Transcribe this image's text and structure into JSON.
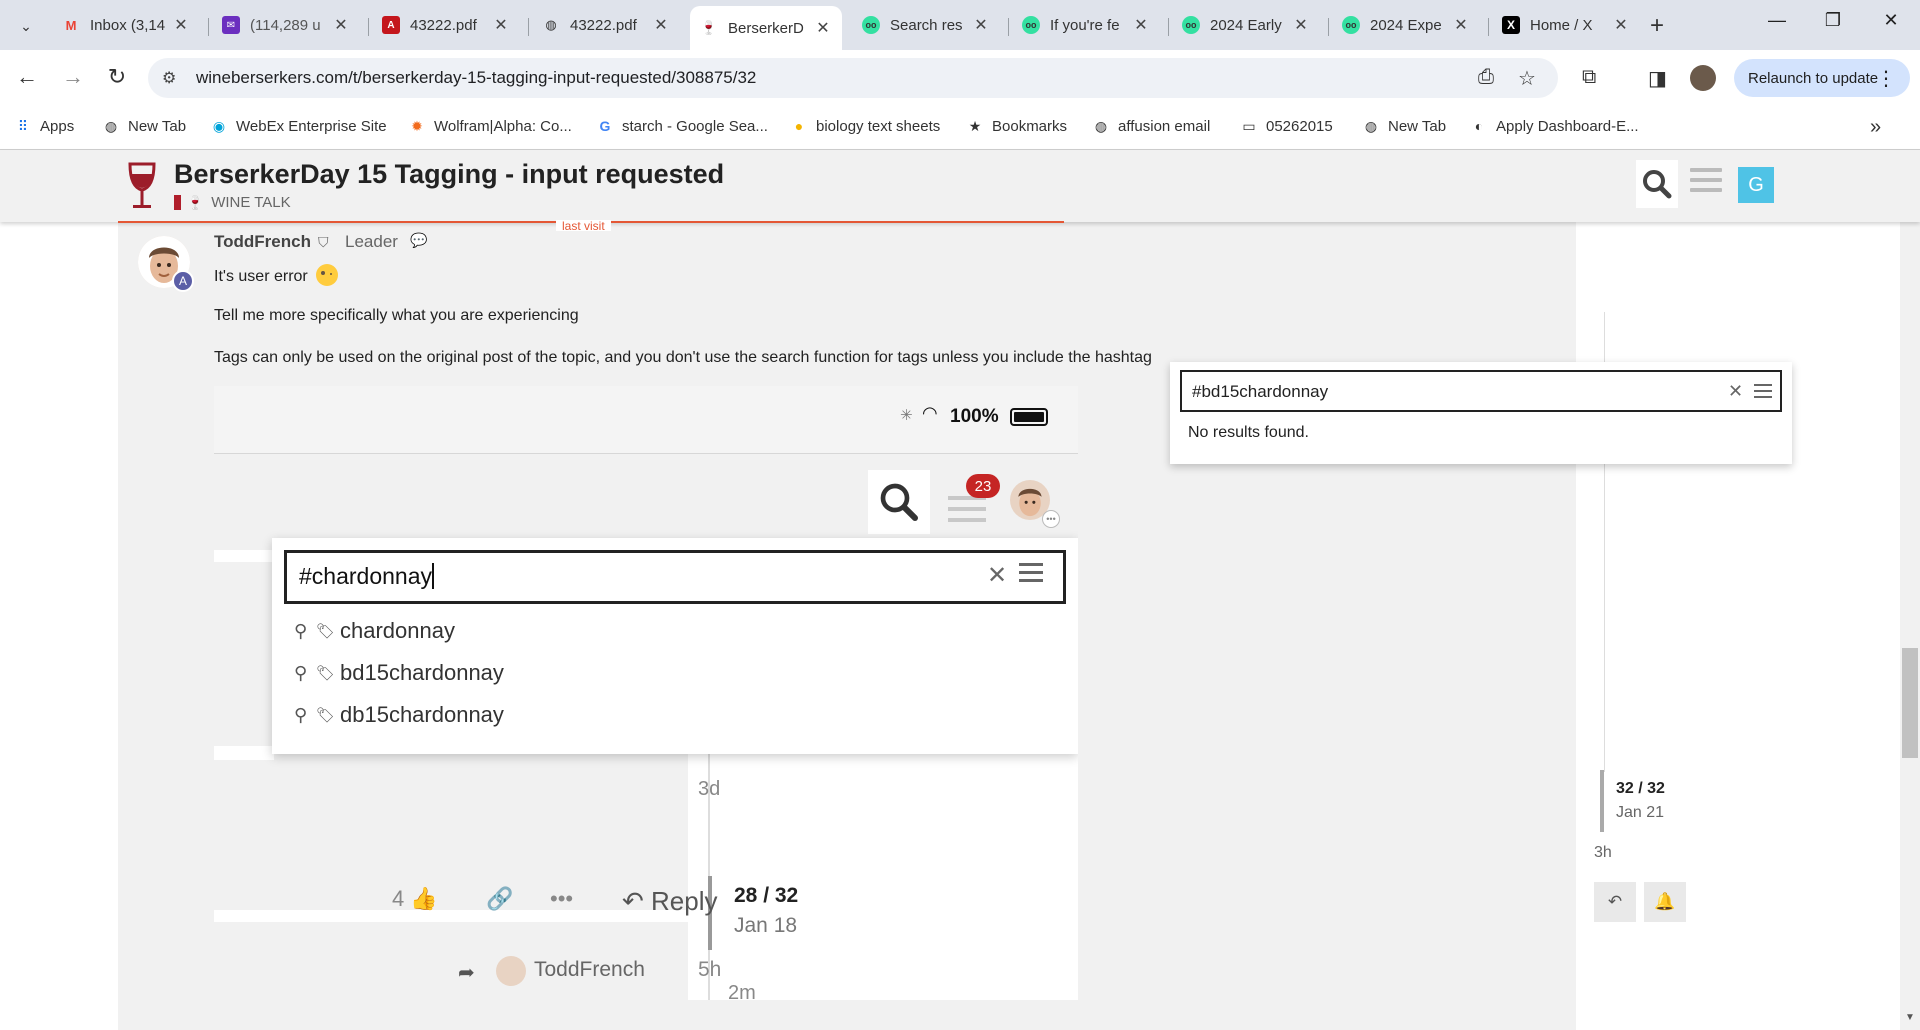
{
  "browser": {
    "tabs": [
      {
        "title": "Inbox (3,14",
        "icon": "gmail-icon",
        "active": false
      },
      {
        "title": "(114,289 u",
        "icon": "mail-icon",
        "active": false
      },
      {
        "title": "43222.pdf",
        "icon": "pdf-icon",
        "active": false
      },
      {
        "title": "43222.pdf",
        "icon": "globe-icon",
        "active": false
      },
      {
        "title": "BerserkerD",
        "icon": "wine-glass-icon",
        "active": true
      },
      {
        "title": "Search res",
        "icon": "tripadvisor-icon",
        "active": false
      },
      {
        "title": "If you're fe",
        "icon": "tripadvisor-icon",
        "active": false
      },
      {
        "title": "2024 Early",
        "icon": "tripadvisor-icon",
        "active": false
      },
      {
        "title": "2024 Expe",
        "icon": "tripadvisor-icon",
        "active": false
      },
      {
        "title": "Home / X",
        "icon": "x-logo-icon",
        "active": false
      }
    ],
    "url": "wineberserkers.com/t/berserkerday-15-tagging-input-requested/308875/32",
    "relaunch_label": "Relaunch to update",
    "bookmarks": [
      {
        "label": "Apps",
        "icon": "apps-grid-icon"
      },
      {
        "label": "New Tab",
        "icon": "globe-icon"
      },
      {
        "label": "WebEx Enterprise Site",
        "icon": "webex-icon"
      },
      {
        "label": "Wolfram|Alpha: Co...",
        "icon": "wolfram-icon"
      },
      {
        "label": "starch - Google Sea...",
        "icon": "google-icon"
      },
      {
        "label": "biology text sheets",
        "icon": "circle-icon"
      },
      {
        "label": "Bookmarks",
        "icon": "star-icon"
      },
      {
        "label": "affusion email",
        "icon": "globe-icon"
      },
      {
        "label": "05262015",
        "icon": "folder-icon"
      },
      {
        "label": "New Tab",
        "icon": "globe-icon"
      },
      {
        "label": "Apply Dashboard-E...",
        "icon": "github-icon"
      }
    ]
  },
  "header": {
    "title": "BerserkerDay 15 Tagging - input requested",
    "category": "WINE TALK",
    "user_initial": "G",
    "last_visit": "last visit"
  },
  "post": {
    "username": "ToddFrench",
    "user_title": "Leader",
    "avatar_badge": "A",
    "lines": [
      "It's user error",
      "Tell me more specifically what you are experiencing",
      "Tags can only be used on the original post of the topic, and you don't use the search function for tags unless you include the hashtag"
    ]
  },
  "embed": {
    "battery": "100%",
    "notification_count": "23",
    "search_value": "#chardonnay",
    "suggestions": [
      "chardonnay",
      "bd15chardonnay",
      "db15chardonnay"
    ],
    "age": "3d",
    "likes": "4",
    "reply_label": "Reply",
    "progress": "28 / 32",
    "progress_date": "Jan 18",
    "timeline_gap": "2m",
    "reply_author": "ToddFrench",
    "reply_age": "5h"
  },
  "timeline": {
    "progress": "32 / 32",
    "date": "Jan 21",
    "ago": "3h"
  },
  "search": {
    "value": "#bd15chardonnay",
    "no_results": "No results found."
  }
}
